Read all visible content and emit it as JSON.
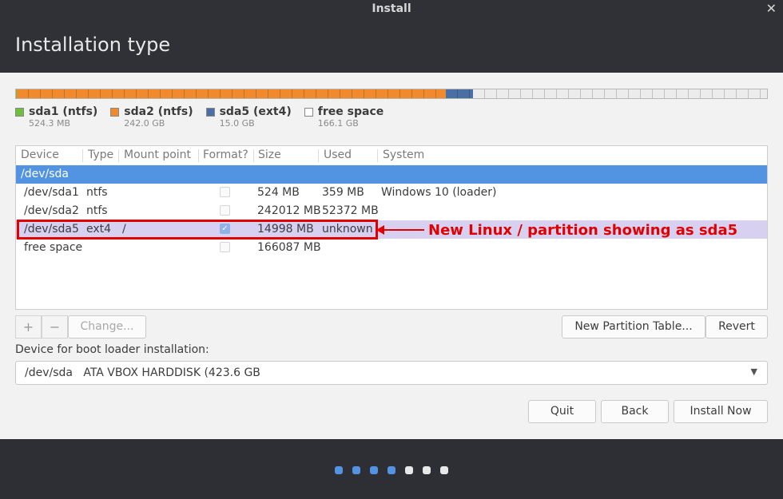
{
  "window": {
    "title": "Install",
    "close_icon": "close-icon"
  },
  "header": {
    "title": "Installation type"
  },
  "partition_bar": {
    "segments": [
      {
        "name": "sda1",
        "color": "#6cbe3c",
        "fraction": 0.0012
      },
      {
        "name": "sda2",
        "color": "#f08a2c",
        "fraction": 0.5716
      },
      {
        "name": "sda5",
        "color": "#4a6fa5",
        "fraction": 0.0354
      },
      {
        "name": "free",
        "color": "#ececec",
        "fraction": 0.3918
      }
    ]
  },
  "legend": [
    {
      "name": "sda1 (ntfs)",
      "size": "524.3 MB",
      "color": "#6cbe3c"
    },
    {
      "name": "sda2 (ntfs)",
      "size": "242.0 GB",
      "color": "#f08a2c"
    },
    {
      "name": "sda5 (ext4)",
      "size": "15.0 GB",
      "color": "#4a6fa5"
    },
    {
      "name": "free space",
      "size": "166.1 GB",
      "color": "#ffffff"
    }
  ],
  "table": {
    "headers": {
      "device": "Device",
      "type": "Type",
      "mount": "Mount point",
      "format": "Format?",
      "size": "Size",
      "used": "Used",
      "system": "System"
    },
    "disk_row": "/dev/sda",
    "rows": [
      {
        "device": "/dev/sda1",
        "type": "ntfs",
        "mount": "",
        "format": false,
        "size": "524 MB",
        "used": "359 MB",
        "system": "Windows 10 (loader)"
      },
      {
        "device": "/dev/sda2",
        "type": "ntfs",
        "mount": "",
        "format": false,
        "size": "242012 MB",
        "used": "52372 MB",
        "system": ""
      },
      {
        "device": "/dev/sda5",
        "type": "ext4",
        "mount": "/",
        "format": true,
        "size": "14998 MB",
        "used": "unknown",
        "system": ""
      },
      {
        "device": "free space",
        "type": "",
        "mount": "",
        "format": false,
        "size": "166087 MB",
        "used": "",
        "system": ""
      }
    ]
  },
  "annotation": {
    "text": "New Linux / partition showing as sda5"
  },
  "toolbar": {
    "add": "+",
    "remove": "−",
    "change": "Change...",
    "new_table": "New Partition Table...",
    "revert": "Revert"
  },
  "bootloader": {
    "label": "Device for boot loader installation:",
    "value": "/dev/sda   ATA VBOX HARDDISK (423.6 GB"
  },
  "buttons": {
    "quit": "Quit",
    "back": "Back",
    "install": "Install Now"
  },
  "progress_dots": {
    "total": 7,
    "done": 4,
    "done_color": "#5294e2",
    "todo_color": "#e8e8e8"
  }
}
